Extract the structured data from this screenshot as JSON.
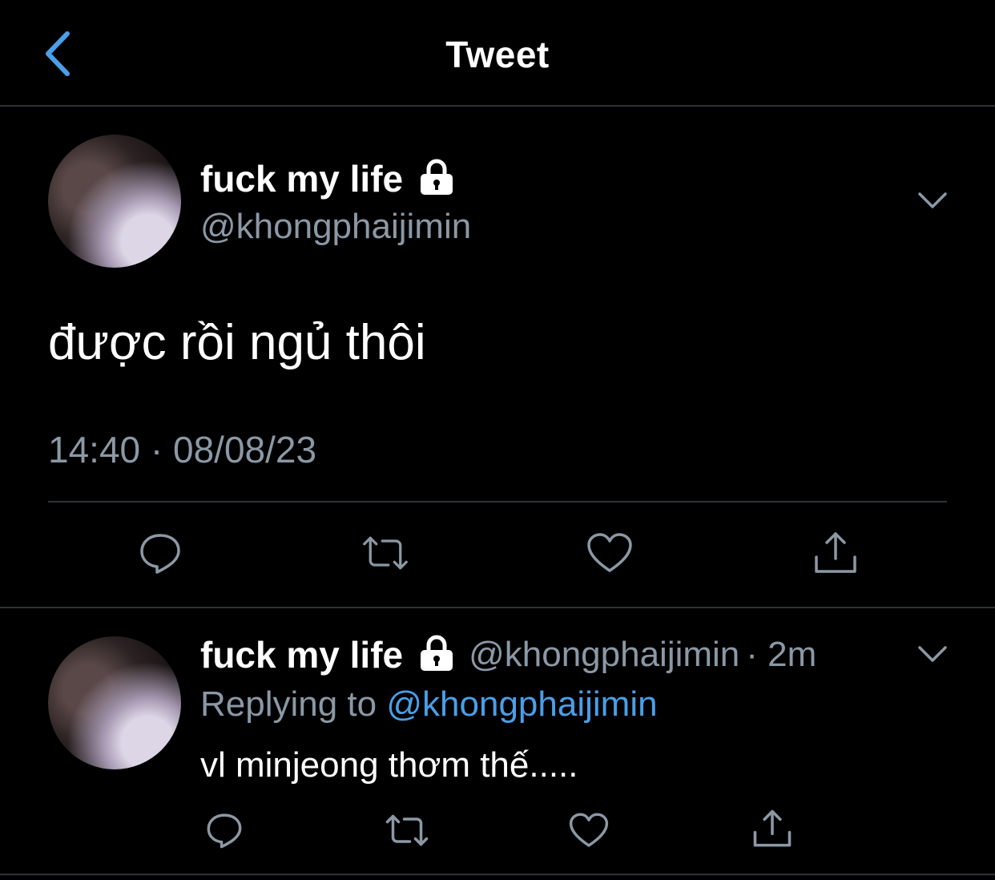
{
  "header": {
    "title": "Tweet",
    "back_icon": "chevron-left-icon",
    "accent": "#4a9fe8"
  },
  "main_tweet": {
    "display_name": "fuck my life",
    "handle": "@khongphaijimin",
    "protected_icon": "lock-icon",
    "text": "được rồi ngủ thôi",
    "timestamp": "14:40 · 08/08/23",
    "actions": [
      "reply-icon",
      "retweet-icon",
      "like-icon",
      "share-icon"
    ]
  },
  "reply": {
    "display_name": "fuck my life",
    "handle": "@khongphaijimin",
    "time": "· 2m",
    "replying_prefix": "Replying to",
    "replying_handle": "@khongphaijimin",
    "text": "vl minjeong thơm thế....."
  },
  "colors": {
    "background": "#000000",
    "secondary_text": "#8b98a5",
    "divider": "#2f3336",
    "link": "#4a9fe8"
  }
}
